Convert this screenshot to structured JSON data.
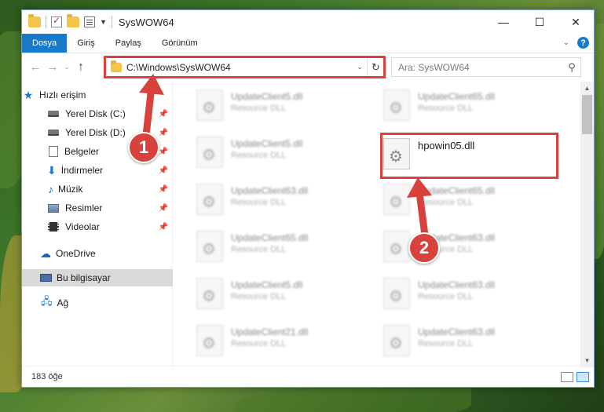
{
  "window": {
    "title": "SysWOW64",
    "controls": {
      "minimize": "—",
      "maximize": "☐",
      "close": "✕"
    }
  },
  "ribbon": {
    "tabs": [
      "Dosya",
      "Giriş",
      "Paylaş",
      "Görünüm"
    ],
    "help": "?"
  },
  "navigation": {
    "address": "C:\\Windows\\SysWOW64",
    "search_placeholder": "Ara: SysWOW64"
  },
  "sidebar": {
    "quick_access": "Hızlı erişim",
    "items": [
      {
        "label": "Yerel Disk (C:)",
        "icon": "drive-icon",
        "pinned": true
      },
      {
        "label": "Yerel Disk (D:)",
        "icon": "drive-icon",
        "pinned": true
      },
      {
        "label": "Belgeler",
        "icon": "documents-icon",
        "pinned": true
      },
      {
        "label": "İndirmeler",
        "icon": "download-icon",
        "pinned": true
      },
      {
        "label": "Müzik",
        "icon": "music-icon",
        "pinned": true
      },
      {
        "label": "Resimler",
        "icon": "pictures-icon",
        "pinned": true
      },
      {
        "label": "Videolar",
        "icon": "videos-icon",
        "pinned": true
      }
    ],
    "onedrive": "OneDrive",
    "this_pc": "Bu bilgisayar",
    "network": "Ağ"
  },
  "files": [
    {
      "name": "UpdateClient5.dll",
      "type": "Resource DLL"
    },
    {
      "name": "UpdateClient65.dll",
      "type": "Resource DLL"
    },
    {
      "name": "UpdateClient5.dll",
      "type": "Resource DLL"
    },
    {
      "name": "hpowin05.dll",
      "type": ""
    },
    {
      "name": "UpdateClient63.dll",
      "type": "Resource DLL"
    },
    {
      "name": "UpdateClient65.dll",
      "type": "Resource DLL"
    },
    {
      "name": "UpdateClient65.dll",
      "type": "Resource DLL"
    },
    {
      "name": "UpdateClient63.dll",
      "type": "Resource DLL"
    },
    {
      "name": "UpdateClient5.dll",
      "type": "Resource DLL"
    },
    {
      "name": "UpdateClient63.dll",
      "type": "Resource DLL"
    },
    {
      "name": "UpdateClient21.dll",
      "type": "Resource DLL"
    },
    {
      "name": "UpdateClient63.dll",
      "type": "Resource DLL"
    }
  ],
  "status": {
    "count": "183 öğe"
  },
  "annotations": {
    "step1": "1",
    "step2": "2"
  },
  "colors": {
    "accent": "#1979ca",
    "highlight": "#d9413d"
  }
}
